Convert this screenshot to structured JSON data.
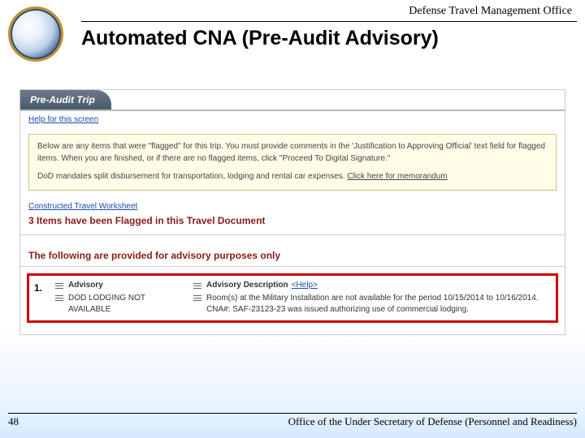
{
  "header": {
    "office": "Defense Travel Management Office",
    "title": "Automated CNA (Pre-Audit Advisory)"
  },
  "preaudit": {
    "tab_label": "Pre-Audit Trip",
    "help_link": "Help for this screen",
    "notice_line1": "Below are any items that were \"flagged\" for this trip. You must provide comments in the 'Justification to Approving Official' text field for flagged items. When you are finished, or if there are no flagged items, click \"Proceed To Digital Signature.\"",
    "notice_line2_pre": "DoD mandates split disbursement for transportation, lodging and rental car expenses. ",
    "notice_line2_link": "Click here for memorandum",
    "constructed_link": "Constructed Travel Worksheet",
    "flag_count_text": "3 Items have been Flagged in this Travel Document",
    "advisory_heading": "The following are provided for advisory purposes only",
    "advisory_item": {
      "num": "1.",
      "col_left_head": "Advisory",
      "col_right_head": "Advisory Description",
      "col_right_help": "<Help>",
      "left_body": "DOD LODGING NOT AVAILABLE",
      "right_body": "Room(s) at the Military Installation are not available for the period 10/15/2014 to 10/16/2014. CNA#: SAF-23123-23 was issued authorizing use of commercial lodging."
    }
  },
  "footer": {
    "page": "48",
    "org": "Office of the Under Secretary of Defense (Personnel and Readiness)"
  }
}
